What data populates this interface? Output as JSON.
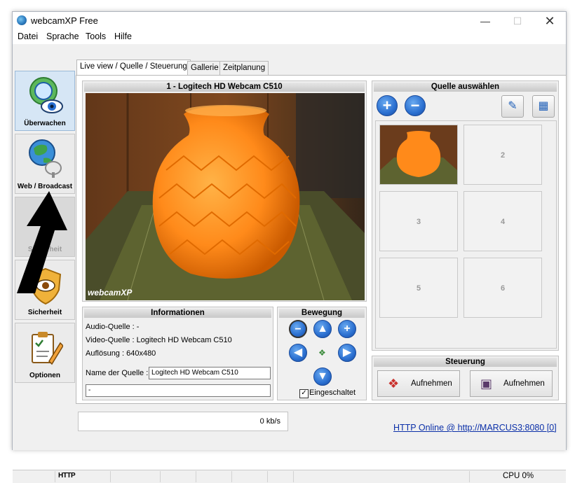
{
  "window": {
    "title": "webcamXP Free"
  },
  "menu": [
    "Datei",
    "Sprache",
    "Tools",
    "Hilfe"
  ],
  "sidebar": {
    "items": [
      {
        "label": "Überwachen"
      },
      {
        "label": "Web / Broadcast"
      },
      {
        "label": "Sicherheit"
      },
      {
        "label": "Sicherheit"
      },
      {
        "label": "Optionen"
      }
    ]
  },
  "tabs": [
    "Live view / Quelle / Steuerung",
    "Gallerie",
    "Zeitplanung"
  ],
  "camera": {
    "title": "1 - Logitech HD Webcam C510",
    "watermark": "webcamXP"
  },
  "info": {
    "header": "Informationen",
    "audio": "Audio-Quelle : -",
    "video": "Video-Quelle : Logitech HD Webcam C510",
    "resolution": "Auflösung : 640x480",
    "name_label": "Name der Quelle :",
    "name_value": "Logitech HD Webcam C510",
    "extra_value": "-"
  },
  "movement": {
    "header": "Bewegung",
    "enabled_label": "Eingeschaltet",
    "enabled": true
  },
  "source": {
    "header": "Quelle auswählen",
    "slots": [
      "",
      "2",
      "3",
      "4",
      "5",
      "6"
    ]
  },
  "control": {
    "header": "Steuerung",
    "record_image_label": "Aufnehmen",
    "record_video_label": "Aufnehmen"
  },
  "bandwidth": "0 kb/s",
  "http_link": "HTTP Online @ http://MARCUS3:8080 [0]",
  "status": {
    "http": "HTTP",
    "cpu": "CPU 0%"
  },
  "colors": {
    "accent_blue": "#2a6fd0",
    "link": "#0a2fa8",
    "sidebar_active": "#d6e6f5",
    "vase_orange": "#ff8a1a"
  }
}
